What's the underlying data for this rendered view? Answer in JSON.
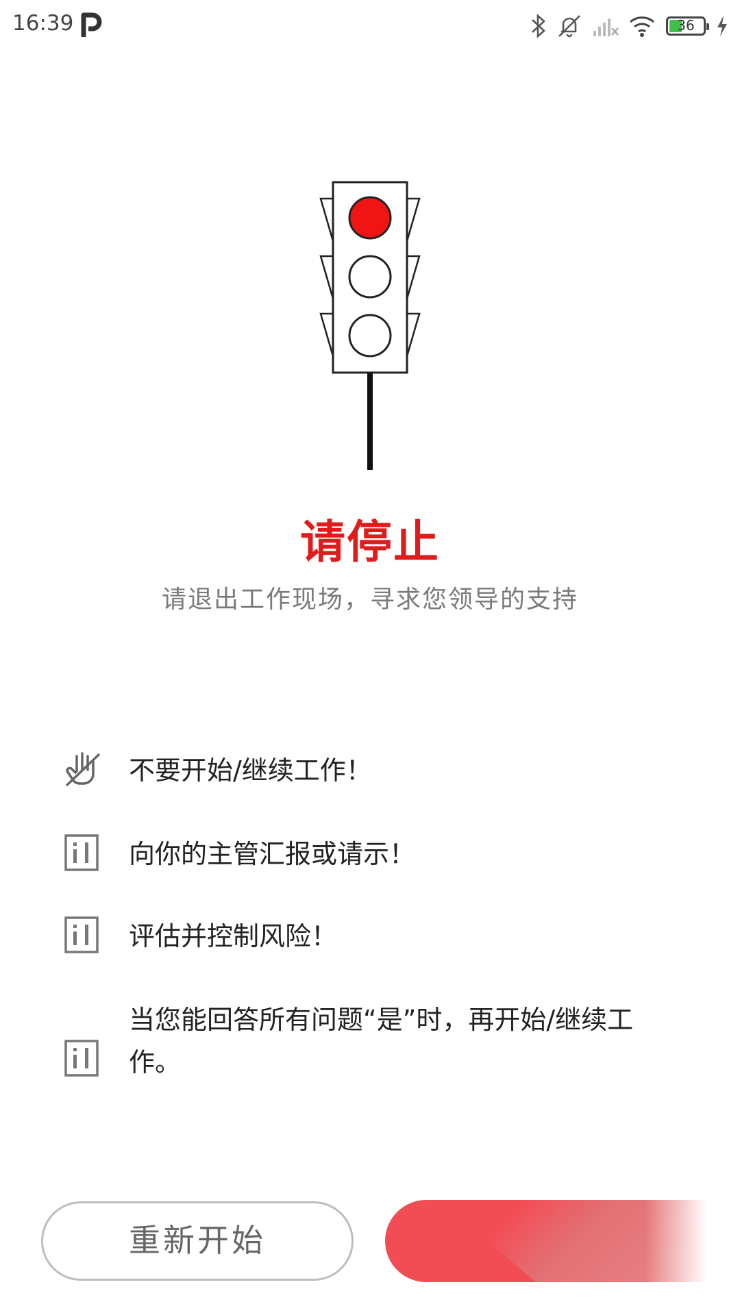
{
  "status_bar": {
    "time": "16:39",
    "battery_level": "36",
    "icons": [
      "parking-app-icon",
      "bluetooth-icon",
      "mute-bell-icon",
      "no-signal-icon",
      "wifi-icon",
      "battery-icon",
      "charging-bolt-icon"
    ]
  },
  "stop_screen": {
    "title": "请停止",
    "subtitle": "请退出工作现场，寻求您领导的支持",
    "accent_color": "#e01b1b",
    "light_state": "red"
  },
  "instructions": [
    {
      "icon": "stop-hand-icon",
      "text": "不要开始/继续工作！"
    },
    {
      "icon": "info-icon",
      "text": "向你的主管汇报或请示！"
    },
    {
      "icon": "info-icon",
      "text": "评估并控制风险！"
    },
    {
      "icon": "info-icon",
      "text": "当您能回答所有问题“是”时，再开始/继续工作。"
    }
  ],
  "buttons": {
    "restart_label": "重新开始"
  }
}
